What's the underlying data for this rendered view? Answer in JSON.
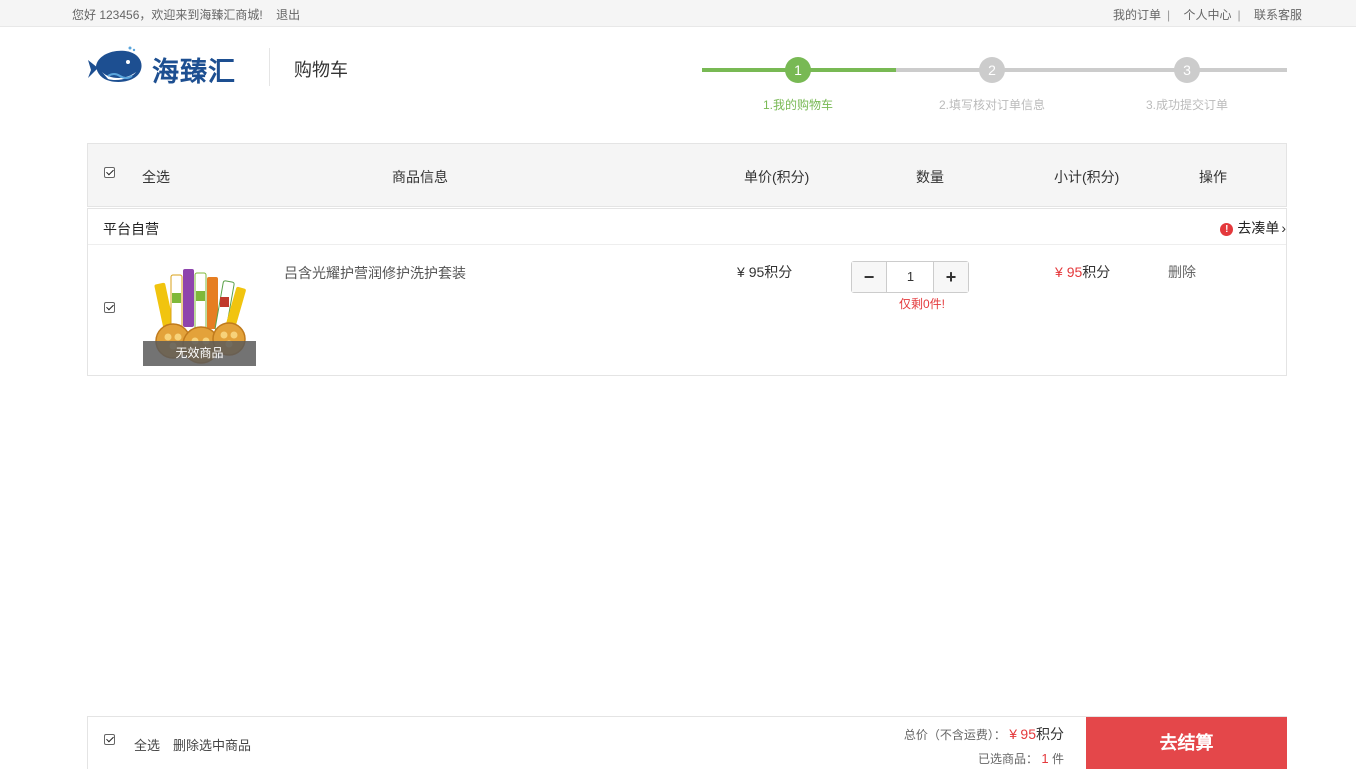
{
  "topbar": {
    "greeting": "您好 123456，欢迎来到海臻汇商城!",
    "logout": "退出",
    "links": [
      "我的订单",
      "个人中心",
      "联系客服"
    ]
  },
  "header": {
    "logo_text": "海臻汇",
    "page_title": "购物车"
  },
  "steps": [
    {
      "num": "1",
      "label": "1.我的购物车"
    },
    {
      "num": "2",
      "label": "2.填写核对订单信息"
    },
    {
      "num": "3",
      "label": "3.成功提交订单"
    }
  ],
  "table_headers": {
    "select_all": "全选",
    "product_info": "商品信息",
    "unit_price": "单价(积分)",
    "quantity": "数量",
    "subtotal": "小计(积分)",
    "action": "操作"
  },
  "shop": {
    "name": "平台自营",
    "coudan": "去凑单",
    "items": [
      {
        "name": "吕含光耀护营润修护洗护套装",
        "invalid_label": "无效商品",
        "price_symbol": "¥",
        "price": "95",
        "price_unit": "积分",
        "quantity": "1",
        "stock_note": "仅剩0件!",
        "subtotal_symbol": "¥",
        "subtotal": "95",
        "subtotal_unit": "积分",
        "delete": "删除"
      }
    ]
  },
  "footer": {
    "select_all": "全选",
    "delete_selected": "删除选中商品",
    "total_label": "总价（不含运费）：",
    "total_symbol": "¥",
    "total_value": "95",
    "total_unit": "积分",
    "selected_label": "已选商品：",
    "selected_count": "1",
    "selected_unit": "件",
    "checkout": "去结算"
  },
  "colors": {
    "accent_green": "#78b954",
    "inactive_gray": "#cccccc",
    "price_red": "#e4393c",
    "checkout_red": "#e4474a",
    "logo_blue": "#1d4f91"
  }
}
